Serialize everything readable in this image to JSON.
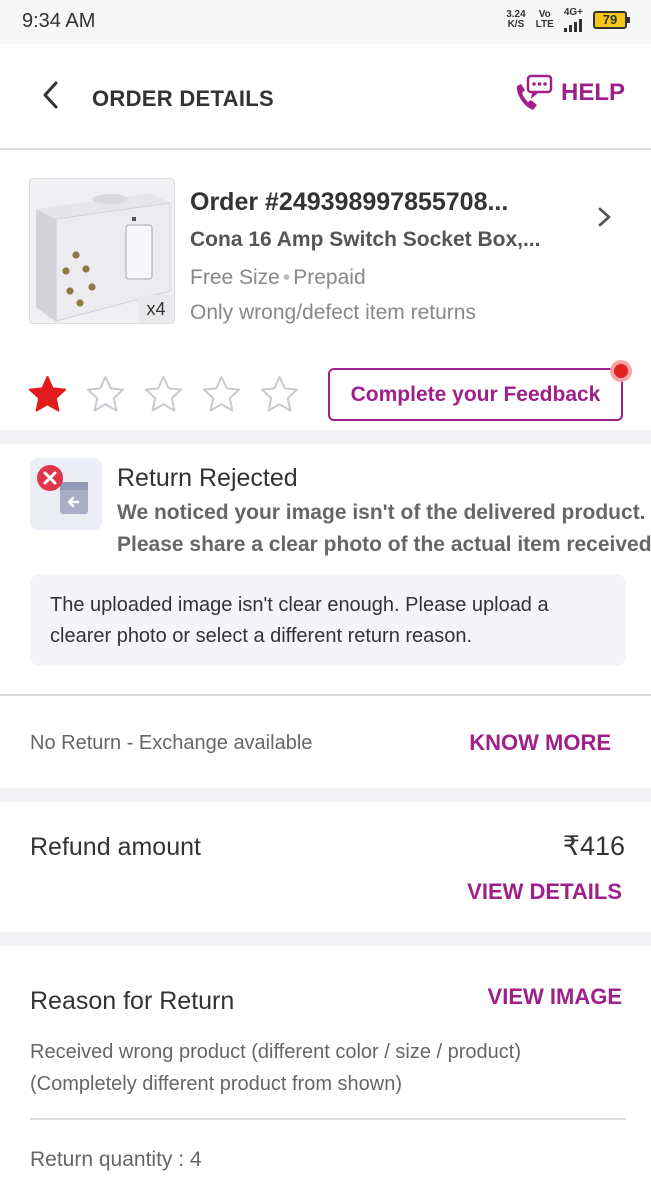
{
  "status_bar": {
    "time": "9:34 AM",
    "net_speed": "3.24",
    "net_unit": "K/S",
    "volte_top": "Vo",
    "volte_bottom": "LTE",
    "network": "4G+",
    "battery": "79"
  },
  "header": {
    "title": "ORDER DETAILS",
    "help_label": "HELP"
  },
  "order": {
    "title": "Order #249398997855708...",
    "product_name": "Cona 16 Amp Switch Socket Box,...",
    "size": "Free Size",
    "payment": "Prepaid",
    "return_policy": "Only wrong/defect item returns",
    "quantity_badge": "x4",
    "rating": 1,
    "rating_max": 5,
    "feedback_button": "Complete your Feedback"
  },
  "return_status": {
    "title": "Return Rejected",
    "line1": "We noticed your image isn't of the delivered product.",
    "line2": "Please share a clear photo of the actual item received.",
    "note": "The uploaded image isn't clear enough. Please upload a clearer photo or select a different return reason."
  },
  "exchange": {
    "text": "No Return - Exchange available",
    "link": "KNOW MORE"
  },
  "refund": {
    "label": "Refund amount",
    "amount": "₹416",
    "link": "VIEW DETAILS"
  },
  "reason": {
    "label": "Reason for Return",
    "link": "VIEW IMAGE",
    "text": "Received wrong product (different color / size / product) (Completely different product from shown)",
    "quantity": "Return quantity : 4"
  },
  "colors": {
    "accent": "#9f2089",
    "star_filled": "#e11b1b",
    "star_empty": "#c8c8d0"
  }
}
